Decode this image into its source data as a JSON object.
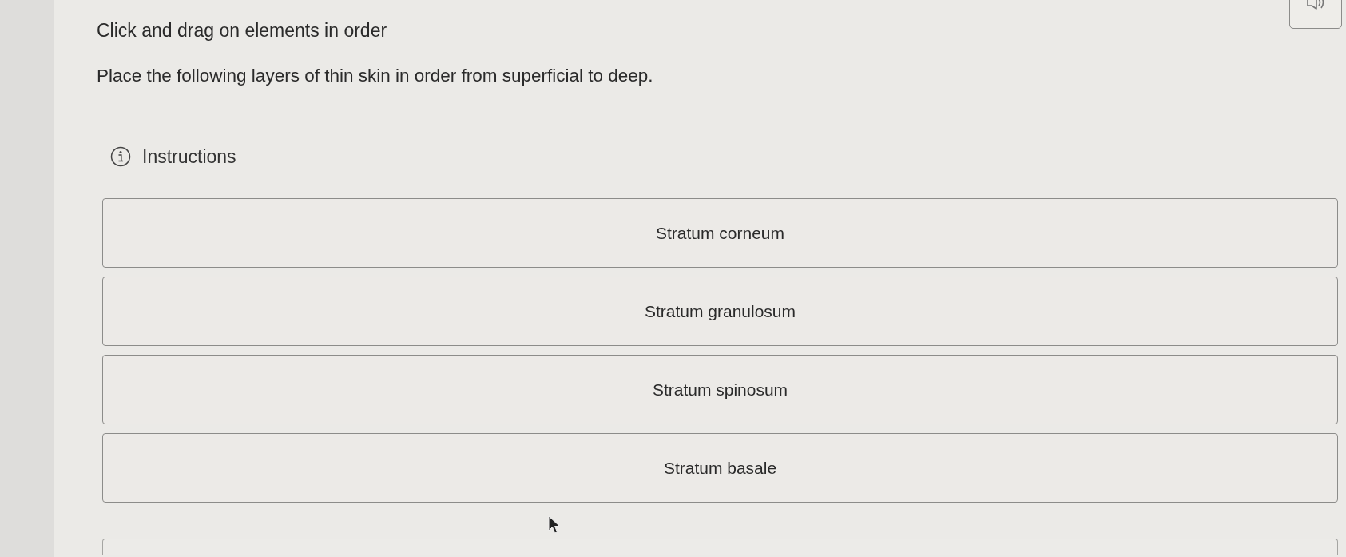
{
  "question": {
    "title": "Click and drag on elements in order",
    "prompt": "Place the following layers of thin skin in order from superficial to deep."
  },
  "instructions": {
    "label": "Instructions"
  },
  "items": [
    {
      "label": "Stratum corneum"
    },
    {
      "label": "Stratum granulosum"
    },
    {
      "label": "Stratum spinosum"
    },
    {
      "label": "Stratum basale"
    }
  ]
}
